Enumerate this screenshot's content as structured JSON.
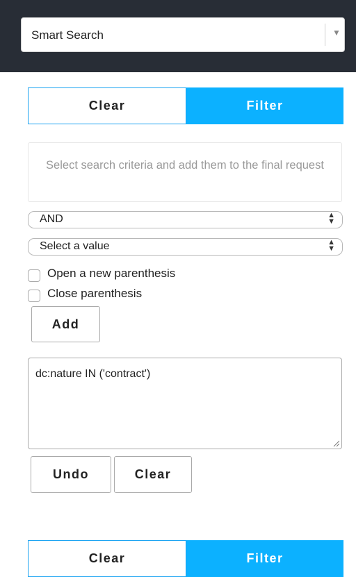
{
  "header": {
    "smart_search_label": "Smart Search",
    "dropdown_arrow": "▼"
  },
  "top_actions": {
    "clear_label": "Clear",
    "filter_label": "Filter"
  },
  "criteria": {
    "hint": "Select search criteria and add them to the final request"
  },
  "operator_select": {
    "value": "AND"
  },
  "value_select": {
    "value": "Select a value"
  },
  "options": {
    "open_parenthesis_label": "Open a new parenthesis",
    "close_parenthesis_label": "Close parenthesis"
  },
  "add_button_label": "Add",
  "request": {
    "text": "dc:nature IN ('contract')"
  },
  "request_actions": {
    "undo_label": "Undo",
    "clear_label": "Clear"
  },
  "bottom_actions": {
    "clear_label": "Clear",
    "filter_label": "Filter"
  },
  "colors": {
    "topbar": "#282d36",
    "accent": "#0cb1ff"
  },
  "icons": {
    "dropdown": "chevron-down-icon",
    "select_updown": "updown-arrows-icon",
    "resize": "resize-handle-icon"
  }
}
